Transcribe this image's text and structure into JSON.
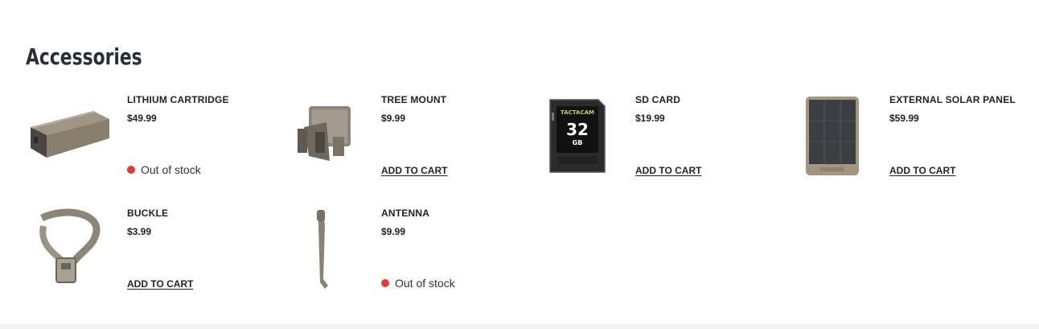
{
  "section": {
    "title": "Accessories"
  },
  "products": [
    {
      "name": "LITHIUM CARTRIDGE",
      "price": "$49.99",
      "status": "Out of stock",
      "icon": "lithium-cartridge-image"
    },
    {
      "name": "TREE MOUNT",
      "price": "$9.99",
      "action": "ADD TO CART",
      "icon": "tree-mount-image"
    },
    {
      "name": "SD CARD",
      "price": "$19.99",
      "action": "ADD TO CART",
      "icon": "sd-card-image",
      "image_text": {
        "brand": "TACTACAM",
        "capacity": "32",
        "unit": "GB"
      }
    },
    {
      "name": "EXTERNAL SOLAR PANEL",
      "price": "$59.99",
      "action": "ADD TO CART",
      "icon": "solar-panel-image"
    },
    {
      "name": "BUCKLE",
      "price": "$3.99",
      "action": "ADD TO CART",
      "icon": "buckle-strap-image"
    },
    {
      "name": "ANTENNA",
      "price": "$9.99",
      "status": "Out of stock",
      "icon": "antenna-image"
    }
  ],
  "colors": {
    "out_of_stock_dot": "#e53935",
    "heading": "#2a2e38",
    "link": "#1f2233"
  }
}
